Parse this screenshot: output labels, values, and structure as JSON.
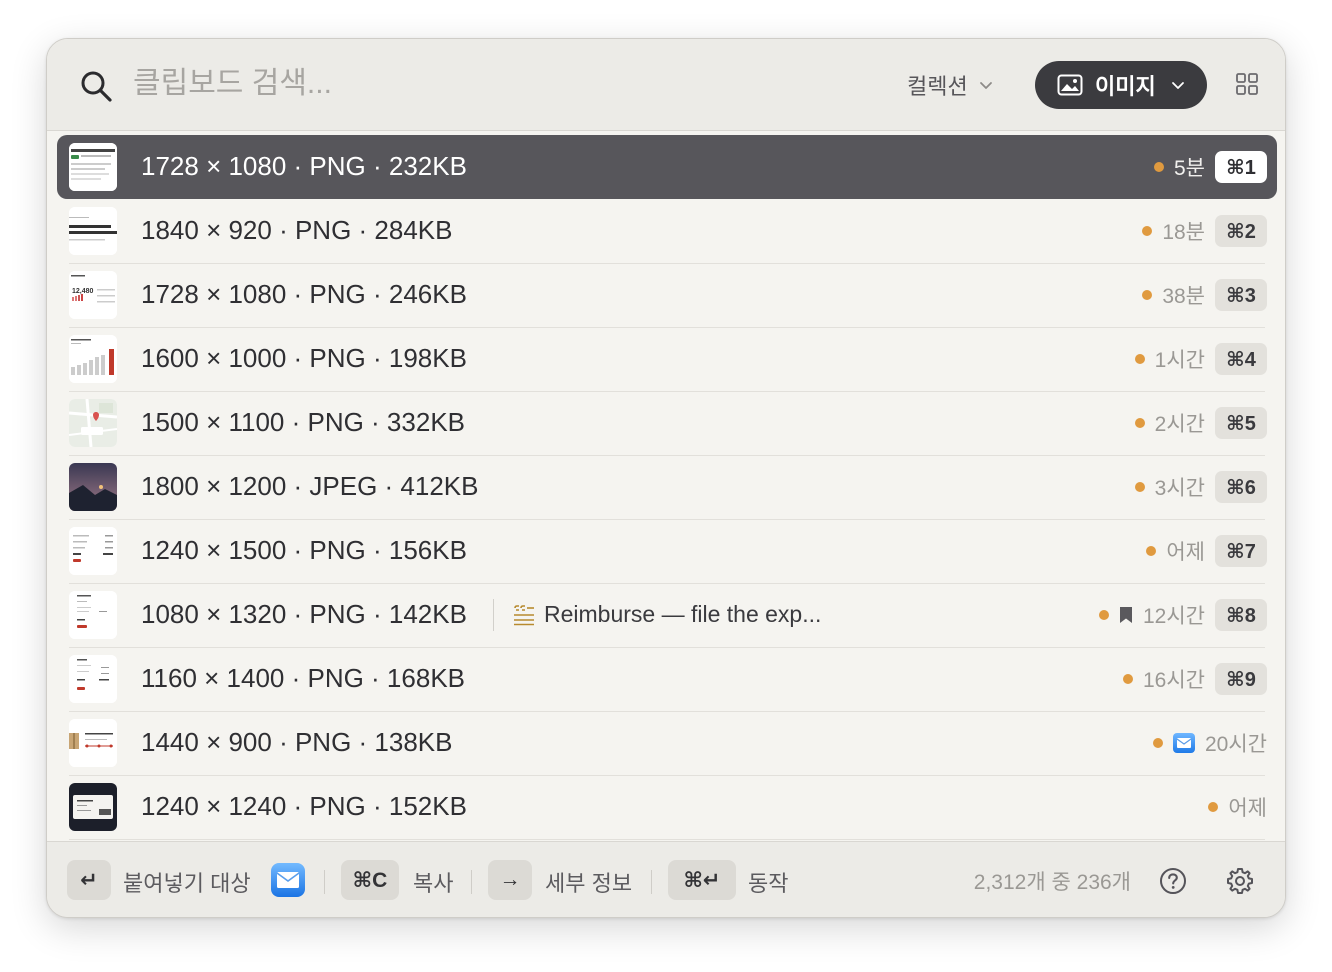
{
  "search": {
    "placeholder": "클립보드 검색..."
  },
  "header": {
    "collection_label": "컬렉션",
    "filter_label": "이미지"
  },
  "items": [
    {
      "title": "1728 × 1080 · PNG · 232KB",
      "time": "5분",
      "shortcut": "⌘1",
      "thumb": "doc-tabs"
    },
    {
      "title": "1840 × 920 · PNG · 284KB",
      "time": "18분",
      "shortcut": "⌘2",
      "thumb": "doc-heading"
    },
    {
      "title": "1728 × 1080 · PNG · 246KB",
      "time": "38분",
      "shortcut": "⌘3",
      "thumb": "dashboard",
      "thumb_text": "12,480"
    },
    {
      "title": "1600 × 1000 · PNG · 198KB",
      "time": "1시간",
      "shortcut": "⌘4",
      "thumb": "bar-chart"
    },
    {
      "title": "1500 × 1100 · PNG · 332KB",
      "time": "2시간",
      "shortcut": "⌘5",
      "thumb": "map"
    },
    {
      "title": "1800 × 1200 · JPEG · 412KB",
      "time": "3시간",
      "shortcut": "⌘6",
      "thumb": "landscape"
    },
    {
      "title": "1240 × 1500 · PNG · 156KB",
      "time": "어제",
      "shortcut": "⌘7",
      "thumb": "receipt"
    },
    {
      "title": "1080 × 1320 · PNG · 142KB",
      "time": "12시간",
      "shortcut": "⌘8",
      "thumb": "receipt2",
      "note": "Reimburse — file the exp...",
      "bookmarked": true
    },
    {
      "title": "1160 × 1400 · PNG · 168KB",
      "time": "16시간",
      "shortcut": "⌘9",
      "thumb": "invoice"
    },
    {
      "title": "1440 × 900 · PNG · 138KB",
      "time": "20시간",
      "thumb": "order",
      "source_app": "mail"
    },
    {
      "title": "1240 × 1240 · PNG · 152KB",
      "time": "어제",
      "thumb": "ticket"
    }
  ],
  "footer": {
    "paste_key": "↵",
    "paste_label": "붙여넣기 대상",
    "copy_key": "⌘C",
    "copy_label": "복사",
    "details_key": "→",
    "details_label": "세부 정보",
    "actions_key": "⌘↵",
    "actions_label": "동작",
    "count": "2,312개 중 236개"
  },
  "colors": {
    "accent_dot": "#e09a3f",
    "selected_bg": "#57565b",
    "chip_bg": "#3b3b3f"
  },
  "icons": [
    "search-icon",
    "chevron-down-icon",
    "image-icon",
    "grid-icon",
    "note-icon",
    "bookmark-icon",
    "mail-icon",
    "help-icon",
    "gear-icon"
  ]
}
